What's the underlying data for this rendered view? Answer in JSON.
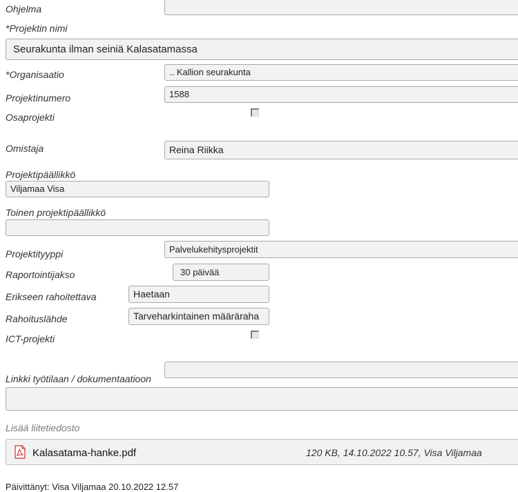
{
  "form": {
    "program": {
      "label": "Ohjelma",
      "value": ""
    },
    "project_name": {
      "label": "*Projektin nimi",
      "value": "Seurakunta ilman seiniä Kalasatamassa"
    },
    "organisation": {
      "label": "*Organisaatio",
      "value": ".. Kallion seurakunta"
    },
    "project_number": {
      "label": "Projektinumero",
      "value": "1588"
    },
    "subproject": {
      "label": "Osaprojekti",
      "checked": false
    },
    "owner": {
      "label": "Omistaja",
      "value": "Reina Riikka"
    },
    "project_manager": {
      "label": "Projektipäällikkö",
      "value": "Viljamaa Visa"
    },
    "second_project_manager": {
      "label": "Toinen projektipäällikkö",
      "value": ""
    },
    "project_type": {
      "label": "Projektityyppi",
      "value": "Palvelukehitysprojektit"
    },
    "reporting_period": {
      "label": "Raportointijakso",
      "value": "30 päivää"
    },
    "separately_funded": {
      "label": "Erikseen rahoitettava",
      "value": "Haetaan"
    },
    "funding_source": {
      "label": "Rahoituslähde",
      "value": "Tarveharkintainen määräraha"
    },
    "ict_project": {
      "label": "ICT-projekti",
      "checked": false
    },
    "workspace_link": {
      "label": "Linkki työtilaan / dokumentaatioon",
      "value": ""
    }
  },
  "attachments": {
    "add_label": "Lisää liitetiedosto",
    "files": [
      {
        "name": "Kalasatama-hanke.pdf",
        "meta": "120 KB, 14.10.2022 10.57, Visa Viljamaa",
        "icon": "pdf-icon"
      }
    ]
  },
  "footer": {
    "updated": "Päivittänyt: Visa Viljamaa 20.10.2022 12.57"
  }
}
